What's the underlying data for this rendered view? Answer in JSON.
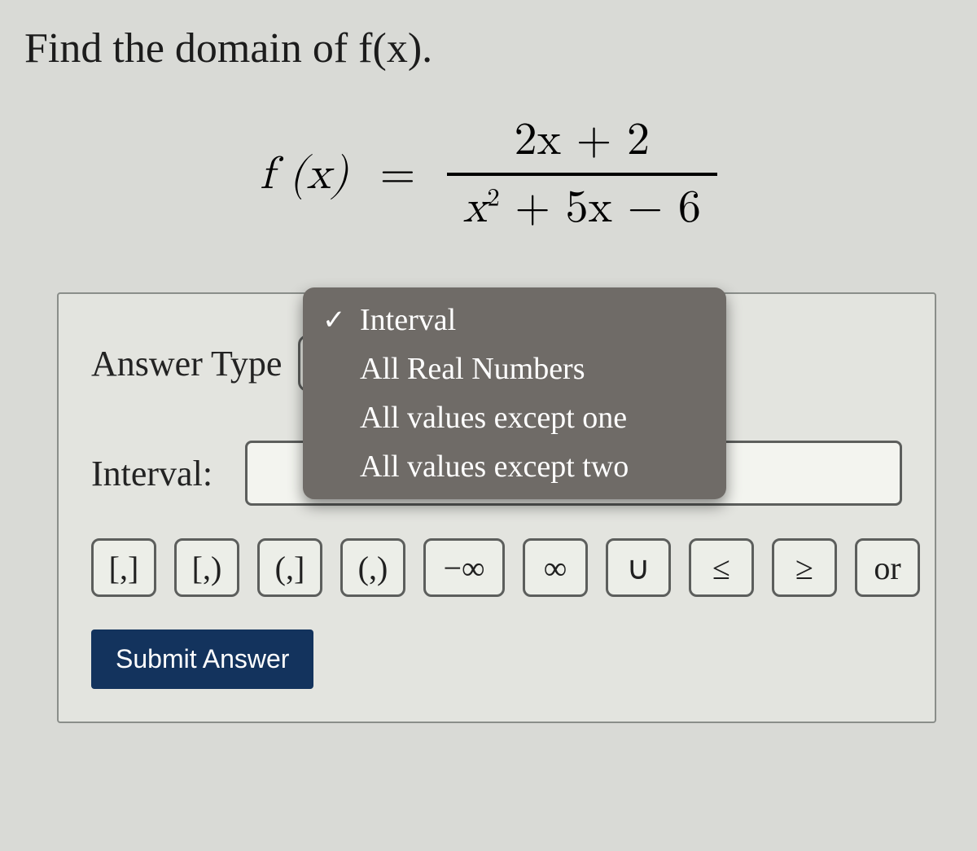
{
  "question": {
    "prompt": "Find the domain of f(x).",
    "equation": {
      "lhs": "f (x)",
      "eq": "=",
      "numerator": "2x + 2",
      "denominator_prefix": "x",
      "denominator_exp": "2",
      "denominator_rest": " + 5x − 6"
    }
  },
  "answer": {
    "type_label": "Answer Type",
    "dropdown": {
      "selected_index": 0,
      "options": [
        "Interval",
        "All Real Numbers",
        "All values except one",
        "All values except two"
      ]
    },
    "interval_label": "Interval:",
    "interval_value": "",
    "symbols": [
      "[,]",
      "[,)",
      "(,]",
      "(,)",
      "−∞",
      "∞",
      "∪",
      "≤",
      "≥",
      "or"
    ],
    "submit_label": "Submit Answer"
  }
}
